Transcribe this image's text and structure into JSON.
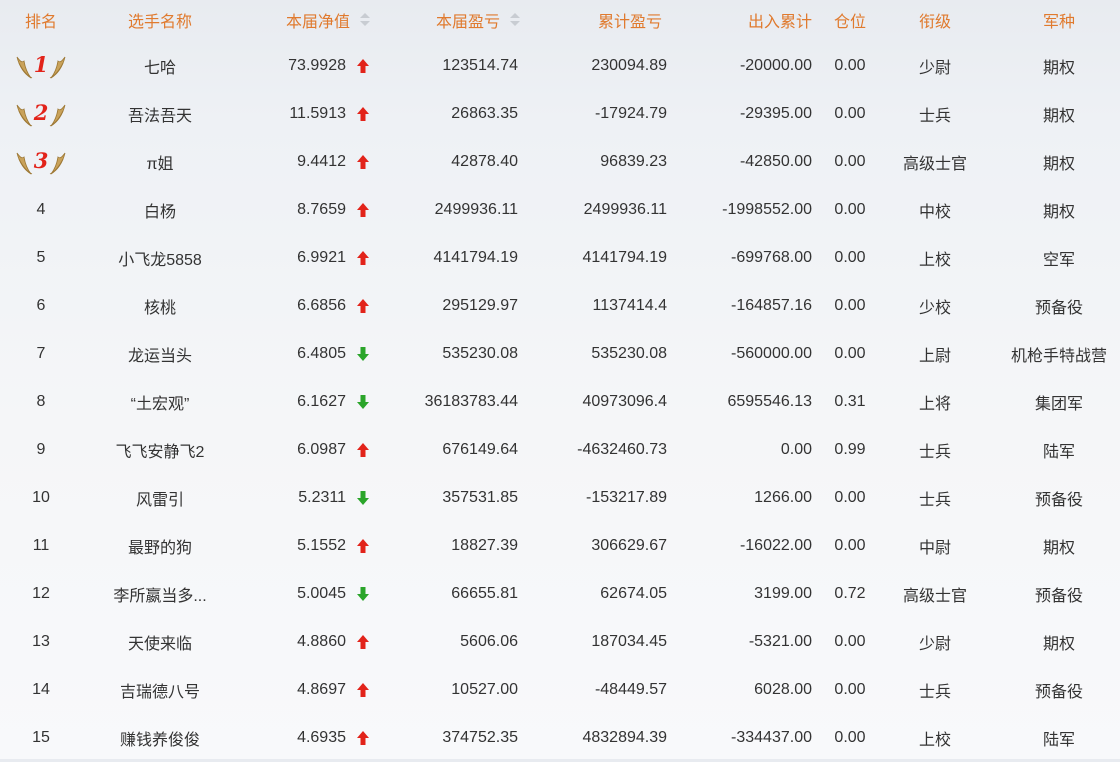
{
  "header": {
    "rank": "排名",
    "name": "选手名称",
    "net_value": "本届净值",
    "profit": "本届盈亏",
    "total_profit": "累计盈亏",
    "in_out": "出入累计",
    "position": "仓位",
    "rank_title": "衔级",
    "branch": "军种"
  },
  "colors": {
    "header_text": "#e07a2e",
    "up": "#e2231a",
    "down": "#2aa52a",
    "medal_num": "#e2231a"
  },
  "rows": [
    {
      "rank": "1",
      "medal": true,
      "name": "七哈",
      "net_value": "73.9928",
      "trend": "up",
      "profit": "123514.74",
      "total_profit": "230094.89",
      "in_out": "-20000.00",
      "position": "0.00",
      "title": "少尉",
      "branch": "期权"
    },
    {
      "rank": "2",
      "medal": true,
      "name": "吾法吾天",
      "net_value": "11.5913",
      "trend": "up",
      "profit": "26863.35",
      "total_profit": "-17924.79",
      "in_out": "-29395.00",
      "position": "0.00",
      "title": "士兵",
      "branch": "期权"
    },
    {
      "rank": "3",
      "medal": true,
      "name": "π姐",
      "net_value": "9.4412",
      "trend": "up",
      "profit": "42878.40",
      "total_profit": "96839.23",
      "in_out": "-42850.00",
      "position": "0.00",
      "title": "高级士官",
      "branch": "期权"
    },
    {
      "rank": "4",
      "medal": false,
      "name": "白杨",
      "net_value": "8.7659",
      "trend": "up",
      "profit": "2499936.11",
      "total_profit": "2499936.11",
      "in_out": "-1998552.00",
      "position": "0.00",
      "title": "中校",
      "branch": "期权"
    },
    {
      "rank": "5",
      "medal": false,
      "name": "小飞龙5858",
      "net_value": "6.9921",
      "trend": "up",
      "profit": "4141794.19",
      "total_profit": "4141794.19",
      "in_out": "-699768.00",
      "position": "0.00",
      "title": "上校",
      "branch": "空军"
    },
    {
      "rank": "6",
      "medal": false,
      "name": "核桃",
      "net_value": "6.6856",
      "trend": "up",
      "profit": "295129.97",
      "total_profit": "1137414.4",
      "in_out": "-164857.16",
      "position": "0.00",
      "title": "少校",
      "branch": "预备役"
    },
    {
      "rank": "7",
      "medal": false,
      "name": "龙运当头",
      "net_value": "6.4805",
      "trend": "down",
      "profit": "535230.08",
      "total_profit": "535230.08",
      "in_out": "-560000.00",
      "position": "0.00",
      "title": "上尉",
      "branch": "机枪手特战营"
    },
    {
      "rank": "8",
      "medal": false,
      "name": "“土宏观”",
      "net_value": "6.1627",
      "trend": "down",
      "profit": "36183783.44",
      "total_profit": "40973096.4",
      "in_out": "6595546.13",
      "position": "0.31",
      "title": "上将",
      "branch": "集团军"
    },
    {
      "rank": "9",
      "medal": false,
      "name": "飞飞安静飞2",
      "net_value": "6.0987",
      "trend": "up",
      "profit": "676149.64",
      "total_profit": "-4632460.73",
      "in_out": "0.00",
      "position": "0.99",
      "title": "士兵",
      "branch": "陆军"
    },
    {
      "rank": "10",
      "medal": false,
      "name": "风雷引",
      "net_value": "5.2311",
      "trend": "down",
      "profit": "357531.85",
      "total_profit": "-153217.89",
      "in_out": "1266.00",
      "position": "0.00",
      "title": "士兵",
      "branch": "预备役"
    },
    {
      "rank": "11",
      "medal": false,
      "name": "最野的狗",
      "net_value": "5.1552",
      "trend": "up",
      "profit": "18827.39",
      "total_profit": "306629.67",
      "in_out": "-16022.00",
      "position": "0.00",
      "title": "中尉",
      "branch": "期权"
    },
    {
      "rank": "12",
      "medal": false,
      "name": "李所嬴当多...",
      "net_value": "5.0045",
      "trend": "down",
      "profit": "66655.81",
      "total_profit": "62674.05",
      "in_out": "3199.00",
      "position": "0.72",
      "title": "高级士官",
      "branch": "预备役"
    },
    {
      "rank": "13",
      "medal": false,
      "name": "天使来临",
      "net_value": "4.8860",
      "trend": "up",
      "profit": "5606.06",
      "total_profit": "187034.45",
      "in_out": "-5321.00",
      "position": "0.00",
      "title": "少尉",
      "branch": "期权"
    },
    {
      "rank": "14",
      "medal": false,
      "name": "吉瑞德八号",
      "net_value": "4.8697",
      "trend": "up",
      "profit": "10527.00",
      "total_profit": "-48449.57",
      "in_out": "6028.00",
      "position": "0.00",
      "title": "士兵",
      "branch": "预备役"
    },
    {
      "rank": "15",
      "medal": false,
      "name": "赚钱养俊俊",
      "net_value": "4.6935",
      "trend": "up",
      "profit": "374752.35",
      "total_profit": "4832894.39",
      "in_out": "-334437.00",
      "position": "0.00",
      "title": "上校",
      "branch": "陆军"
    }
  ]
}
